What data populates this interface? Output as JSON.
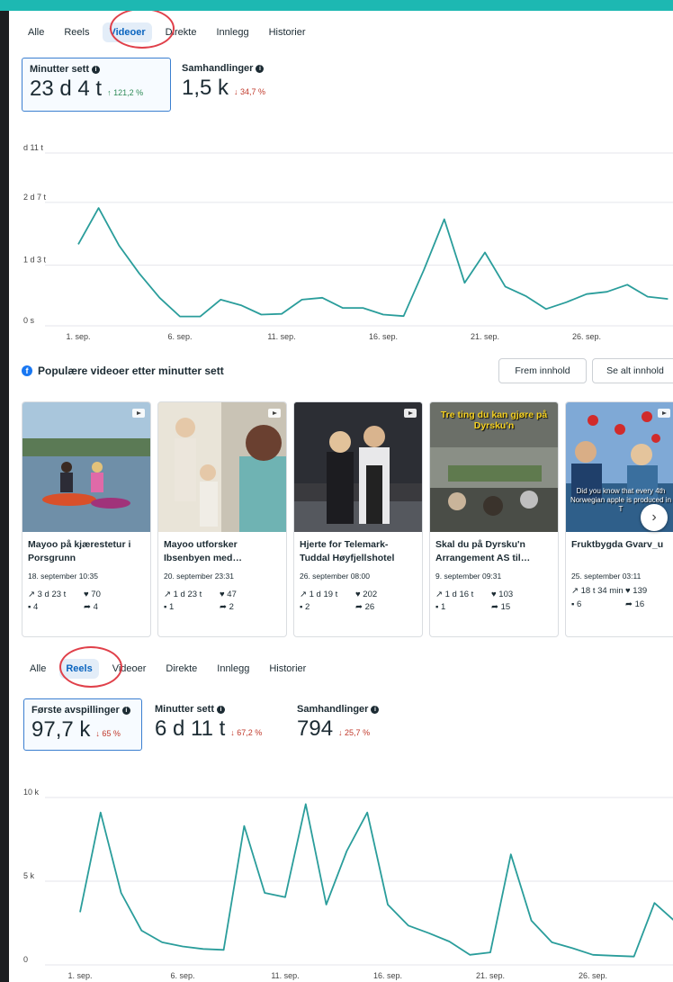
{
  "tabs_top": {
    "items": [
      "Alle",
      "Reels",
      "Videoer",
      "Direkte",
      "Innlegg",
      "Historier"
    ],
    "active": "Videoer"
  },
  "metrics_top": [
    {
      "label": "Minutter sett",
      "value": "23 d 4 t",
      "change": "↑ 121,2 %",
      "direction": "up",
      "selected": true
    },
    {
      "label": "Samhandlinger",
      "value": "1,5 k",
      "change": "↓ 34,7 %",
      "direction": "down",
      "selected": false
    }
  ],
  "chart_top_labels": {
    "x_ticks": [
      "1. sep.",
      "6. sep.",
      "11. sep.",
      "16. sep.",
      "21. sep.",
      "26. sep."
    ]
  },
  "popular": {
    "title": "Populære videoer etter minutter sett",
    "btn_frem": "Frem innhold",
    "btn_se_alt": "Se alt innhold"
  },
  "cards": [
    {
      "title": "Mayoo på kjærestetur i Porsgrunn",
      "date": "18. september 10:35",
      "minutes": "3 d 23 t",
      "likes": "70",
      "comments": "4",
      "shares": "4"
    },
    {
      "title": "Mayoo utforsker Ibsenbyen med…",
      "date": "20. september 23:31",
      "minutes": "1 d 23 t",
      "likes": "47",
      "comments": "1",
      "shares": "2"
    },
    {
      "title": "Hjerte for Telemark-Tuddal Høyfjellshotel",
      "date": "26. september 08:00",
      "minutes": "1 d 19 t",
      "likes": "202",
      "comments": "2",
      "shares": "26"
    },
    {
      "title": "Skal du på Dyrsku'n Arrangement AS til…",
      "date": "9. september 09:31",
      "minutes": "1 d 16 t",
      "likes": "103",
      "comments": "1",
      "shares": "15",
      "overlay": "Tre ting du kan gjøre på Dyrsku'n"
    },
    {
      "title": "Fruktbygda Gvarv_u",
      "date": "25. september 03:11",
      "minutes": "18 t 34 min",
      "likes": "139",
      "comments": "6",
      "shares": "16",
      "overlay": "Did you know that every 4th Norwegian apple is produced in T"
    }
  ],
  "tabs_bottom": {
    "items": [
      "Alle",
      "Reels",
      "Videoer",
      "Direkte",
      "Innlegg",
      "Historier"
    ],
    "active": "Reels"
  },
  "metrics_bottom": [
    {
      "label": "Første avspillinger",
      "value": "97,7 k",
      "change": "↓ 65 %",
      "direction": "down",
      "selected": true
    },
    {
      "label": "Minutter sett",
      "value": "6 d 11 t",
      "change": "↓ 67,2 %",
      "direction": "down",
      "selected": false
    },
    {
      "label": "Samhandlinger",
      "value": "794",
      "change": "↓ 25,7 %",
      "direction": "down",
      "selected": false
    }
  ],
  "chart_data": [
    {
      "type": "line",
      "y_tick_labels": [
        "0 s",
        "1 d 3 t",
        "2 d 7 t",
        "d 11 t"
      ],
      "x_tick_labels": [
        "1. sep.",
        "6. sep.",
        "11. sep.",
        "16. sep.",
        "21. sep.",
        "26. sep."
      ],
      "ylim_minutes": [
        0,
        4620
      ],
      "series": [
        {
          "color": "#2a9d9b",
          "x": [
            1,
            2,
            3,
            4,
            5,
            6,
            7,
            8,
            9,
            10,
            11,
            12,
            13,
            14,
            15,
            16,
            17,
            18,
            19,
            20,
            21,
            22,
            23,
            24,
            25,
            26,
            27,
            28,
            29
          ],
          "values_minutes": [
            2180,
            3150,
            2150,
            1400,
            750,
            250,
            250,
            700,
            550,
            300,
            320,
            700,
            750,
            480,
            480,
            300,
            260,
            1500,
            2850,
            1150,
            1960,
            1050,
            800,
            450,
            630,
            850,
            910,
            1100,
            780,
            720
          ]
        }
      ]
    },
    {
      "type": "line",
      "y_tick_labels": [
        "0",
        "5 k",
        "10 k"
      ],
      "x_tick_labels": [
        "1. sep.",
        "6. sep.",
        "11. sep.",
        "16. sep.",
        "21. sep.",
        "26. sep."
      ],
      "ylim": [
        0,
        10000
      ],
      "series": [
        {
          "color": "#2a9d9b",
          "x": [
            1,
            2,
            3,
            4,
            5,
            6,
            7,
            8,
            9,
            10,
            11,
            12,
            13,
            14,
            15,
            16,
            17,
            18,
            19,
            20,
            21,
            22,
            23,
            24,
            25,
            26,
            27,
            28,
            29,
            30
          ],
          "values": [
            3150,
            9100,
            4300,
            2050,
            1350,
            1100,
            950,
            900,
            8300,
            4300,
            4050,
            9600,
            3600,
            6800,
            9100,
            3600,
            2350,
            1900,
            1400,
            600,
            750,
            6600,
            2650,
            1350,
            1000,
            600,
            550,
            500,
            3700,
            2600
          ]
        }
      ]
    }
  ]
}
